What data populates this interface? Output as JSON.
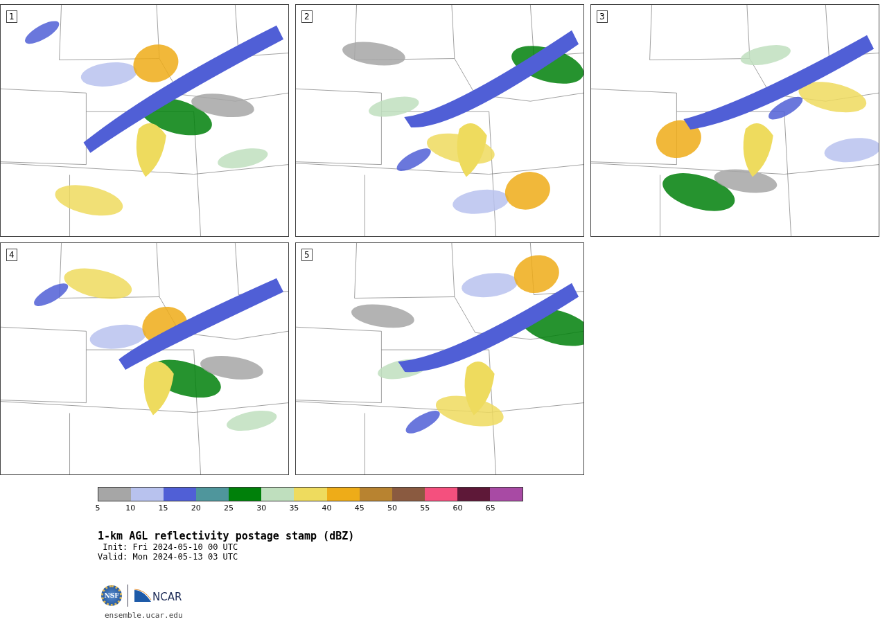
{
  "panels": [
    {
      "label": "1"
    },
    {
      "label": "2"
    },
    {
      "label": "3"
    },
    {
      "label": "4"
    },
    {
      "label": "5"
    }
  ],
  "colorbar": {
    "segments": [
      {
        "color": "#a6a6a6"
      },
      {
        "color": "#b8c2ee"
      },
      {
        "color": "#505fd6"
      },
      {
        "color": "#4f969c"
      },
      {
        "color": "#00800a"
      },
      {
        "color": "#bfdfbe"
      },
      {
        "color": "#eedb5e"
      },
      {
        "color": "#eeac18"
      },
      {
        "color": "#b88330"
      },
      {
        "color": "#8a5a40"
      },
      {
        "color": "#f4507e"
      },
      {
        "color": "#5e1838"
      },
      {
        "color": "#a84aa4"
      }
    ],
    "ticks": [
      "5",
      "10",
      "15",
      "20",
      "25",
      "30",
      "35",
      "40",
      "45",
      "50",
      "55",
      "60",
      "65"
    ]
  },
  "title": "1-km AGL reflectivity postage stamp (dBZ)",
  "init": " Init: Fri 2024-05-10 00 UTC",
  "valid": "Valid: Mon 2024-05-13 03 UTC",
  "logo": {
    "nsf": "NSF",
    "ncar": "NCAR"
  },
  "url": "ensemble.ucar.edu"
}
